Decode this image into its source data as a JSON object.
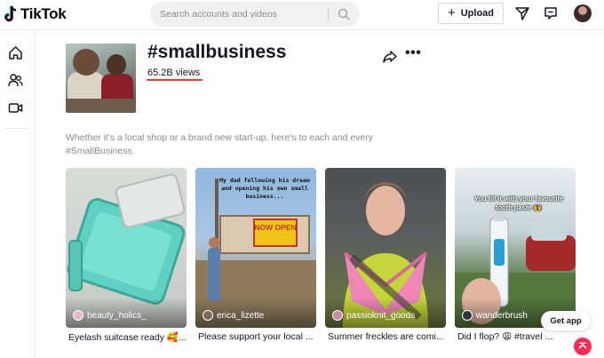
{
  "header": {
    "brand": "TikTok",
    "search_placeholder": "Search accounts and videos",
    "upload_label": "Upload",
    "icons": [
      "search-icon",
      "send-icon",
      "inbox-icon",
      "profile-avatar"
    ]
  },
  "sidebar": {
    "items": [
      {
        "name": "home",
        "icon": "home-icon"
      },
      {
        "name": "following",
        "icon": "following-icon"
      },
      {
        "name": "live",
        "icon": "live-icon"
      }
    ]
  },
  "tag": {
    "title": "#smallbusiness",
    "views": "65.2B views",
    "description": "Whether it's a local shop or a brand new start-up, here's to each and every #SmallBusiness."
  },
  "videos": [
    {
      "user": "beauty_holics_",
      "caption": "Eyelash suitcase ready 🥰...",
      "overlay_text": "",
      "avatar_color": "#e7b9c8"
    },
    {
      "user": "erica_lizette",
      "caption": "Please support your local ...",
      "overlay_text": "My dad following his dream and opening his own small business...",
      "sign_text": "NOW OPEN",
      "avatar_color": "#7a6a5a"
    },
    {
      "user": "passioknit_goods",
      "caption": "Summer freckles are comi...",
      "overlay_text": "",
      "avatar_color": "#c58aa3"
    },
    {
      "user": "wanderbrush",
      "caption": "Did I flop? 😩 #travel ...",
      "overlay_text": "You fill it with your favourite tooth paste 🙌",
      "avatar_color": "#2f3440"
    }
  ],
  "floating": {
    "get_app": "Get app"
  },
  "colors": {
    "accent": "#fe2c55",
    "underline": "#e8392d",
    "muted_text": "#8a8b91"
  }
}
